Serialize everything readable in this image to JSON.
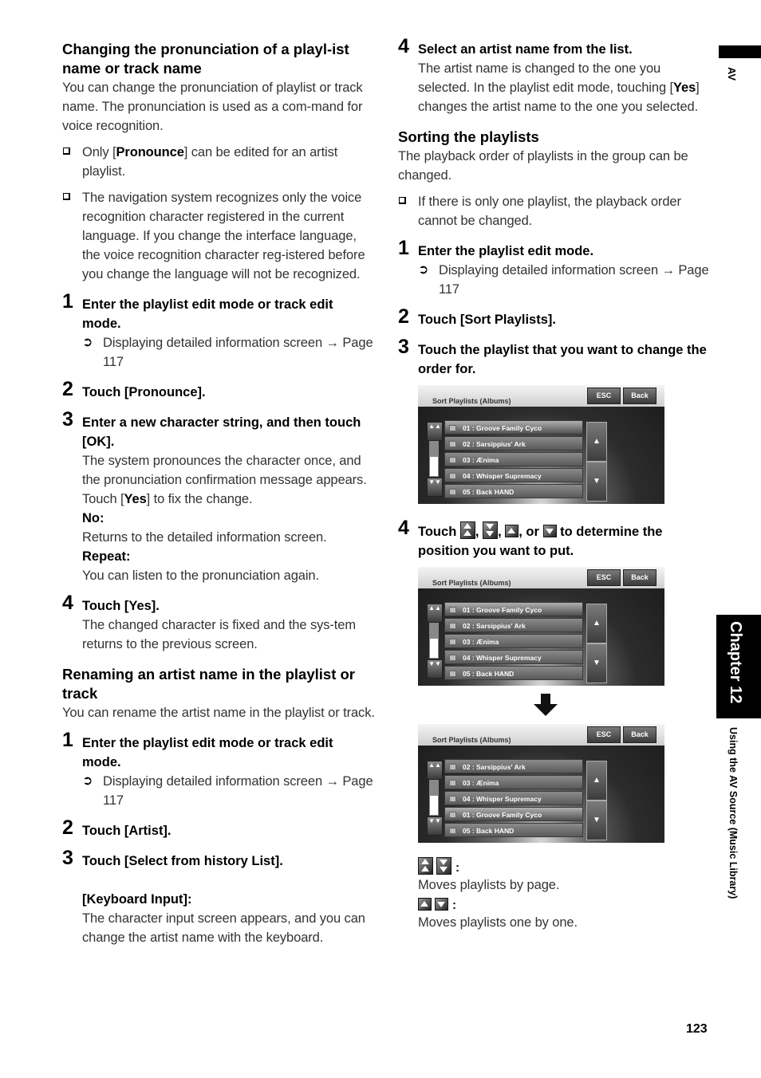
{
  "side_tab": {
    "section": "AV",
    "chapter": "Chapter 12",
    "chapter_title": "Using the AV Source (Music Library)"
  },
  "page_number": "123",
  "left": {
    "pronunciation": {
      "heading": "Changing the pronunciation of a playl-ist name or track name",
      "intro": "You can change the pronunciation of playlist or track name. The pronunciation is used as a com-mand for voice recognition.",
      "notes": [
        {
          "pre": "Only [",
          "bold": "Pronounce",
          "post": "] can be edited for an artist playlist."
        },
        {
          "text": "The navigation system recognizes only the voice recognition character registered in the current language. If you change the interface language, the voice recognition character reg-istered before you change the language will not be recognized."
        }
      ],
      "steps": [
        {
          "num": "1",
          "title": "Enter the playlist edit mode or track edit mode.",
          "ref": "Displaying detailed information screen → Page 117"
        },
        {
          "num": "2",
          "title": "Touch [Pronounce]."
        },
        {
          "num": "3",
          "title": "Enter a new character string, and then touch [OK].",
          "body_pre": "The system pronounces the character once, and the pronunciation confirmation message appears. Touch [",
          "body_bold": "Yes",
          "body_post": "] to fix the change.",
          "options": [
            {
              "label": "No:",
              "text": "Returns to the detailed information screen."
            },
            {
              "label": "Repeat:",
              "text": "You can listen to the pronunciation again."
            }
          ]
        },
        {
          "num": "4",
          "title": "Touch [Yes].",
          "body": "The changed character is fixed and the sys-tem returns to the previous screen."
        }
      ]
    },
    "renaming": {
      "heading": "Renaming an artist name in the playlist or track",
      "intro": "You can rename the artist name in the playlist or track.",
      "steps": [
        {
          "num": "1",
          "title": "Enter the playlist edit mode or track edit mode.",
          "ref": "Displaying detailed information screen → Page 117"
        },
        {
          "num": "2",
          "title": "Touch [Artist]."
        },
        {
          "num": "3",
          "title": "Touch [Select from history List].",
          "option_label": "[Keyboard Input]:",
          "option_text": "The character input screen appears, and you can change the artist name with the keyboard."
        }
      ]
    }
  },
  "right": {
    "rename_step4": {
      "num": "4",
      "title": "Select an artist name from the list.",
      "body_pre": "The artist name is changed to the one you selected. In the playlist edit mode, touching [",
      "body_bold": "Yes",
      "body_post": "] changes the artist name to the one you selected."
    },
    "sorting": {
      "heading": "Sorting the playlists",
      "intro": "The playback order of playlists in the group can be changed.",
      "note": "If there is only one playlist, the playback order cannot be changed.",
      "steps": [
        {
          "num": "1",
          "title": "Enter the playlist edit mode.",
          "ref": "Displaying detailed information screen → Page 117"
        },
        {
          "num": "2",
          "title": "Touch [Sort Playlists]."
        },
        {
          "num": "3",
          "title": "Touch the playlist that you want to change the order for."
        },
        {
          "num": "4",
          "title_pre": "Touch",
          "title_sep1": ",",
          "title_sep2": ",",
          "title_sep3": ", or",
          "title_post": "to determine the position you want to put."
        }
      ],
      "legend": [
        {
          "icons": [
            "page-up-icon",
            "page-down-icon"
          ],
          "colon": ":",
          "text": "Moves playlists by page."
        },
        {
          "icons": [
            "up-icon",
            "down-icon"
          ],
          "colon": ":",
          "text": "Moves playlists one by one."
        }
      ]
    },
    "screens": [
      {
        "title": "Sort Playlists (Albums)",
        "esc": "ESC",
        "back": "Back",
        "rows": [
          "01 : Groove Family Cyco",
          "02 : Sarsippius' Ark",
          "03 : Ænima",
          "04 : Whisper Supremacy",
          "05 : Back HAND"
        ],
        "selected": 0
      },
      {
        "title": "Sort Playlists (Albums)",
        "esc": "ESC",
        "back": "Back",
        "rows": [
          "01 : Groove Family Cyco",
          "02 : Sarsippius' Ark",
          "03 : Ænima",
          "04 : Whisper Supremacy",
          "05 : Back HAND"
        ],
        "selected": 0
      },
      {
        "title": "Sort Playlists (Albums)",
        "esc": "ESC",
        "back": "Back",
        "rows": [
          "02 : Sarsippius' Ark",
          "03 : Ænima",
          "04 : Whisper Supremacy",
          "01 : Groove Family Cyco",
          "05 : Back HAND"
        ],
        "selected": 3
      }
    ],
    "screen_arrows": {
      "up": "▲",
      "down": "▼",
      "page_up": "▲▲",
      "page_down": "▼▼"
    }
  }
}
